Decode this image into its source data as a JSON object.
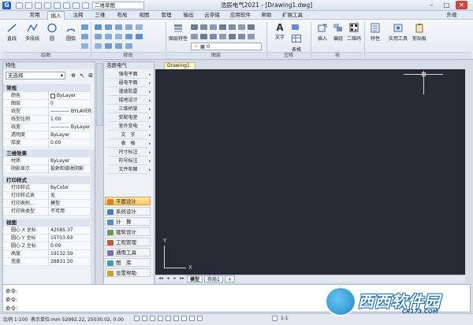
{
  "titlebar": {
    "app_icon": "G",
    "qa_combo": "二维草图",
    "title": "浩辰电气2021 - [Drawing1.dwg]",
    "min": "–",
    "max": "□",
    "close": "✕"
  },
  "menu": [
    "常用",
    "插入",
    "注释",
    "三维",
    "布局",
    "视图",
    "管理",
    "输出",
    "云存储",
    "应用软件",
    "帮助",
    "扩展工具"
  ],
  "menu_right": "外观",
  "ribbon": {
    "tools": [
      "直线",
      "多段线",
      "圆",
      "圆弧",
      "图层特性",
      "插入",
      "文字",
      "表格",
      "编组",
      "二维码",
      "特性",
      "实用工具",
      "剪贴板"
    ],
    "groups": [
      "绘图",
      "修改",
      "图层",
      "注释",
      "块"
    ],
    "layer_value": "0"
  },
  "props": {
    "header": "特性",
    "selection": "无选择",
    "sections": [
      {
        "title": "常规",
        "rows": [
          [
            "颜色",
            "ByLayer"
          ],
          [
            "图层",
            "0"
          ],
          [
            "线型",
            "———— BYLAYER"
          ],
          [
            "线型比例",
            "1.00"
          ],
          [
            "线宽",
            "———— ByLayer"
          ],
          [
            "透明度",
            "ByLayer"
          ],
          [
            "厚度",
            "0.00"
          ]
        ]
      },
      {
        "title": "三维效果",
        "rows": [
          [
            "材质",
            "ByLayer"
          ],
          [
            "阴影显示",
            "投射和接收阴影"
          ]
        ]
      },
      {
        "title": "打印样式",
        "rows": [
          [
            "打印样式",
            "ByColor"
          ],
          [
            "打印样式表",
            "无"
          ],
          [
            "打印表附...",
            "模型"
          ],
          [
            "打印表类型",
            "不可用"
          ]
        ]
      },
      {
        "title": "视图",
        "rows": [
          [
            "圆心 X 坐标",
            "42585.37"
          ],
          [
            "圆心 Y 坐标",
            "15T03.93"
          ],
          [
            "圆心 Z 坐标",
            "0.00"
          ],
          [
            "高度",
            "19132.59"
          ],
          [
            "宽度",
            "28831.50"
          ]
        ]
      }
    ]
  },
  "elec": {
    "header": "浩辰电气",
    "items": [
      "强电平面",
      "弱电平面",
      "漫坡防雷",
      "接地设计",
      "三维桥架",
      "变配电室",
      "室外变电",
      "文　字",
      "表　格",
      "尺寸标注",
      "符号标注",
      "文件布图"
    ],
    "categories": [
      "平面设计",
      "系统设计",
      "计　算",
      "建筑设计",
      "工程管理",
      "通用工具",
      "图　库",
      "设置帮助"
    ],
    "active_category": "平面设计"
  },
  "canvas": {
    "tab": "Drawing1",
    "ucs_y": "Y",
    "ucs_x": "X"
  },
  "layout": {
    "tabs": [
      "模型",
      "布局1"
    ],
    "add": "+"
  },
  "cmd": {
    "lines": [
      "命令:",
      "命令:",
      "命令:"
    ]
  },
  "status": {
    "scale": "比例 1:100",
    "coords": "52992.22, 25030.02, 0.00",
    "right": "1:1"
  },
  "watermark": {
    "text": "西西软件园",
    "url": "CR173.COM"
  }
}
